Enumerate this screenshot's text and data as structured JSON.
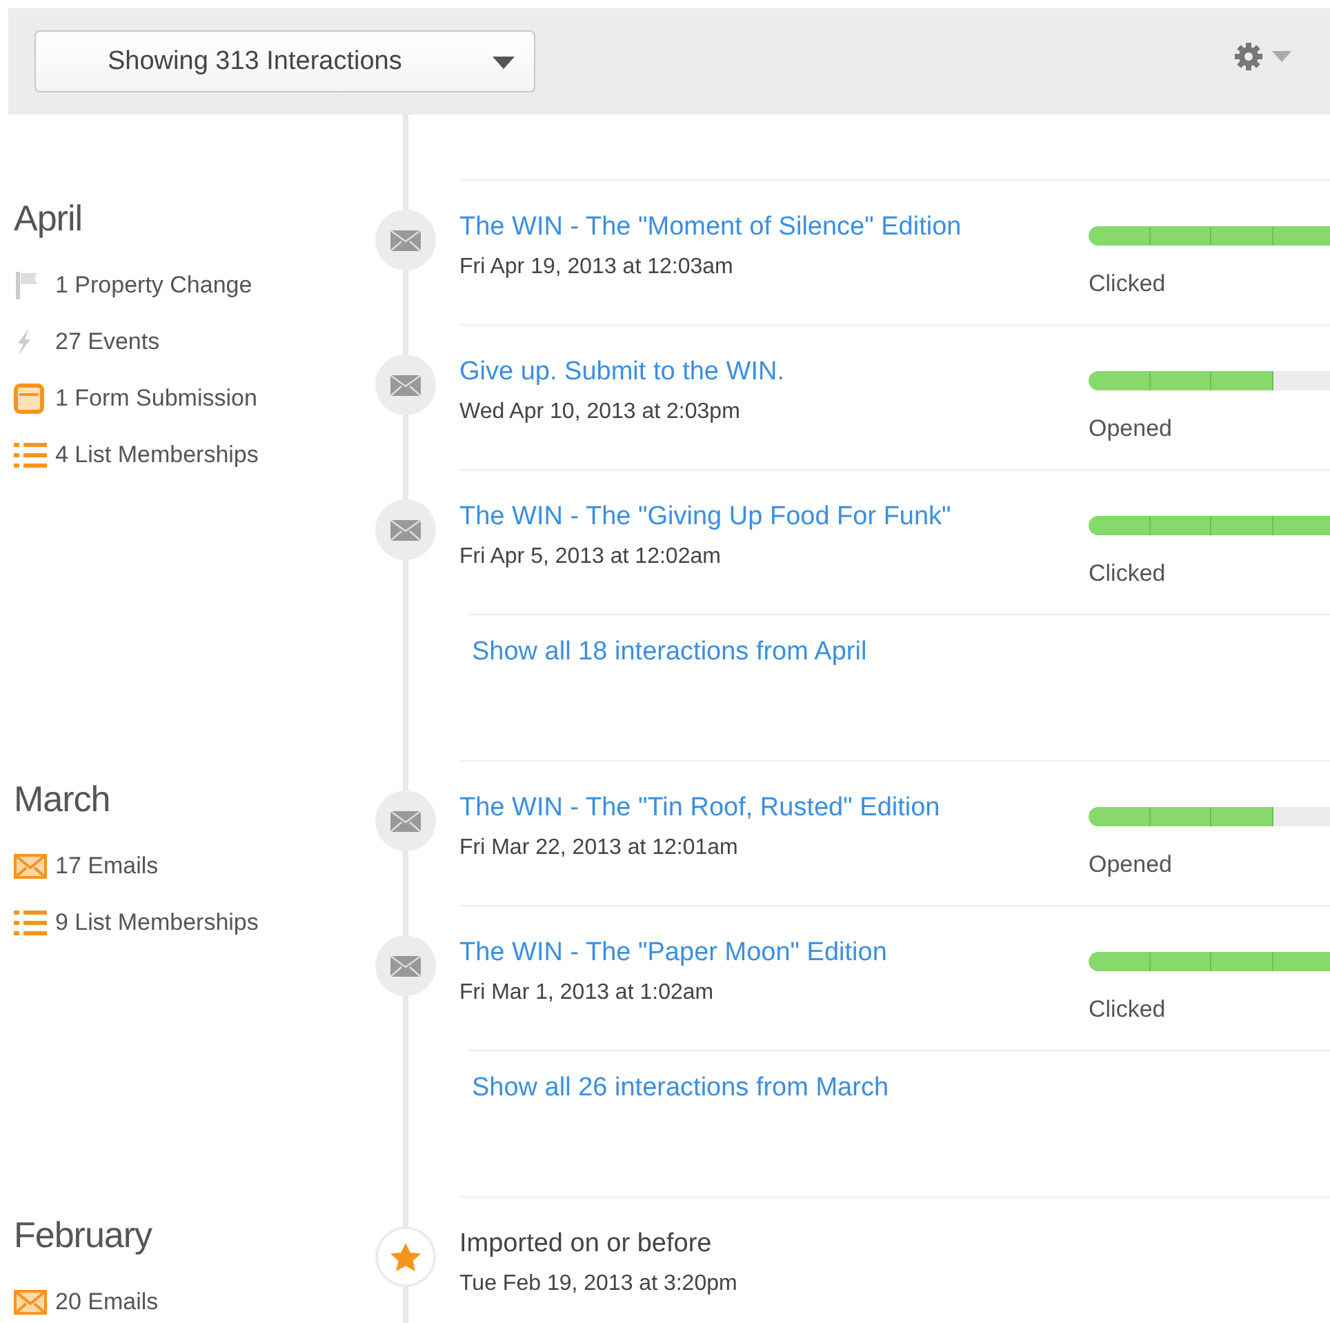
{
  "toolbar": {
    "filter": "Showing 313 Interactions"
  },
  "months": [
    {
      "name": "April",
      "summary": [
        {
          "kind": "property",
          "label": "1 Property Change"
        },
        {
          "kind": "event",
          "label": "27 Events"
        },
        {
          "kind": "form",
          "label": "1 Form Submission"
        },
        {
          "kind": "list",
          "label": "4 List Memberships"
        }
      ],
      "items": [
        {
          "kind": "email",
          "title": "The WIN - The \"Moment of Silence\" Edition",
          "date": "Fri Apr 19, 2013 at 12:03am",
          "status": "Clicked",
          "level": 1
        },
        {
          "kind": "email",
          "title": "Give up. Submit to the WIN.",
          "date": "Wed Apr 10, 2013 at 2:03pm",
          "status": "Opened",
          "level": 0.6
        },
        {
          "kind": "email",
          "title": "The WIN - The \"Giving Up Food For Funk\"",
          "date": "Fri Apr 5, 2013 at 12:02am",
          "status": "Clicked",
          "level": 1
        }
      ],
      "show_all": "Show all 18 interactions from April"
    },
    {
      "name": "March",
      "summary": [
        {
          "kind": "email",
          "label": "17 Emails"
        },
        {
          "kind": "list",
          "label": "9 List Memberships"
        }
      ],
      "items": [
        {
          "kind": "email",
          "title": "The WIN - The \"Tin Roof, Rusted\" Edition",
          "date": "Fri Mar 22, 2013 at 12:01am",
          "status": "Opened",
          "level": 0.6
        },
        {
          "kind": "email",
          "title": "The WIN - The \"Paper Moon\" Edition",
          "date": "Fri Mar 1, 2013 at 1:02am",
          "status": "Clicked",
          "level": 1
        }
      ],
      "show_all": "Show all 26 interactions from March"
    },
    {
      "name": "February",
      "summary": [
        {
          "kind": "email",
          "label": "20 Emails"
        }
      ],
      "items": [
        {
          "kind": "import",
          "title": "Imported on or before",
          "date": "Tue Feb 19, 2013 at 3:20pm"
        }
      ]
    }
  ]
}
